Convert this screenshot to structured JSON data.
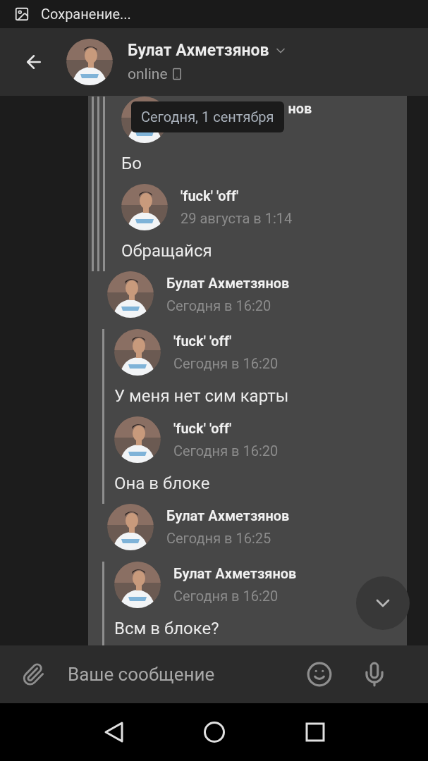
{
  "status_bar": {
    "notification": "Сохранение..."
  },
  "header": {
    "name": "Булат Ахметзянов",
    "status": "online"
  },
  "date_tooltip": "Сегодня, 1 сентября",
  "messages": [
    {
      "kind": "forward",
      "children": [
        {
          "kind": "forward",
          "children": [
            {
              "kind": "forward",
              "children": [
                {
                  "kind": "author",
                  "name": "нов"
                },
                {
                  "kind": "text",
                  "text": "Бо"
                },
                {
                  "kind": "author",
                  "name": "'fuck' 'off'",
                  "time": "29 августа в 1:14"
                },
                {
                  "kind": "text",
                  "text": "Обращайся"
                }
              ]
            }
          ]
        }
      ]
    },
    {
      "kind": "author",
      "name": "Булат Ахметзянов",
      "time": "Сегодня в 16:20"
    },
    {
      "kind": "forward",
      "children": [
        {
          "kind": "author",
          "name": "'fuck' 'off'",
          "time": "Сегодня в 16:20"
        },
        {
          "kind": "text",
          "text": "У меня нет сим карты"
        },
        {
          "kind": "author",
          "name": "'fuck' 'off'",
          "time": "Сегодня в 16:20"
        },
        {
          "kind": "text",
          "text": "Она в блоке"
        }
      ]
    },
    {
      "kind": "author",
      "name": "Булат Ахметзянов",
      "time": "Сегодня в 16:25"
    },
    {
      "kind": "forward",
      "children": [
        {
          "kind": "author",
          "name": "Булат Ахметзянов",
          "time": "Сегодня в 16:20"
        },
        {
          "kind": "text",
          "text": "Всм в блоке?"
        }
      ]
    }
  ],
  "composer": {
    "placeholder": "Ваше сообщение"
  }
}
